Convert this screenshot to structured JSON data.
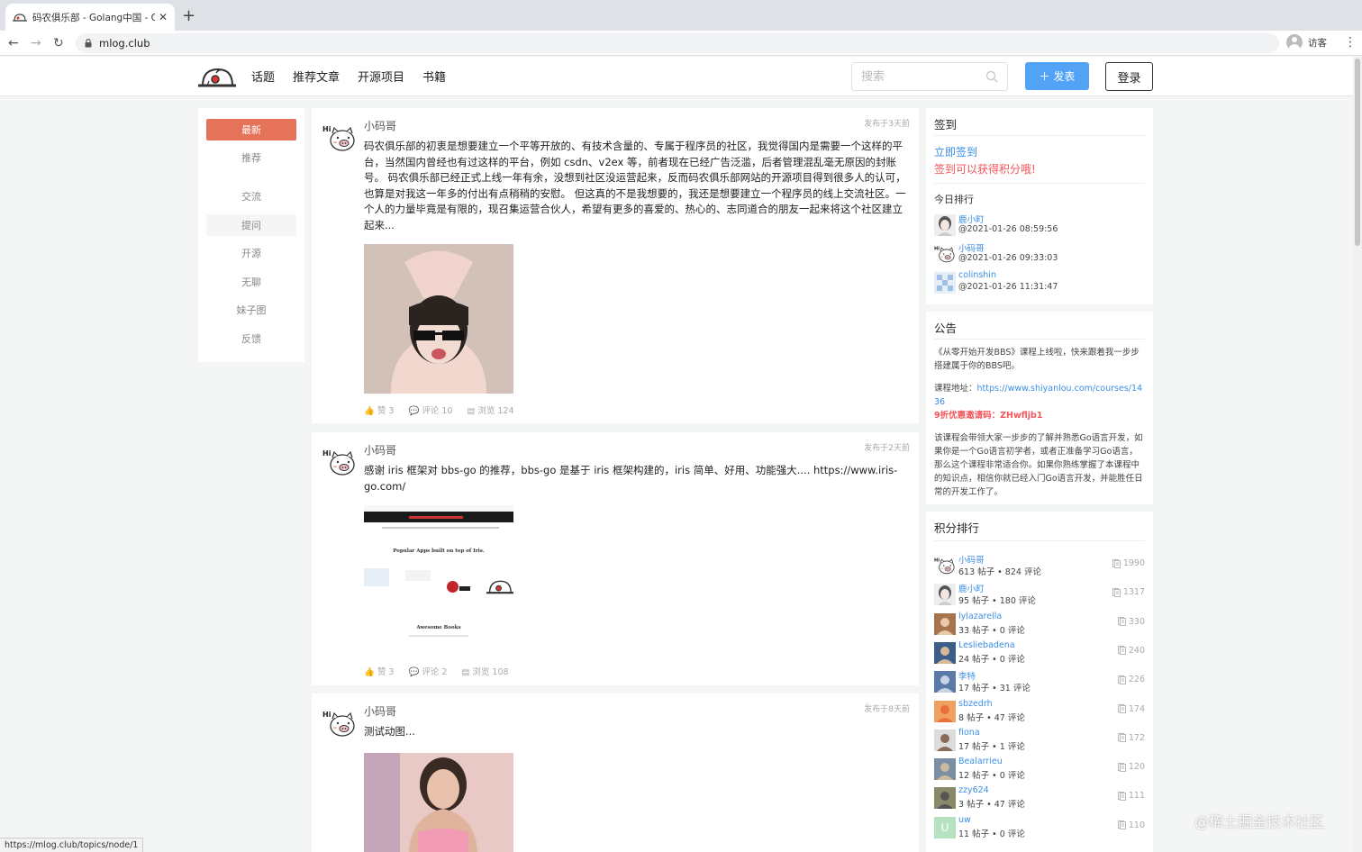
{
  "browser": {
    "tab_title": "码农俱乐部 - Golang中国 - Go语",
    "tab_close": "✕",
    "new_tab": "+",
    "back": "←",
    "forward": "→",
    "reload": "↻",
    "url": "mlog.club",
    "profile_name": "访客",
    "menu": "⋮",
    "status_url": "https://mlog.club/topics/node/1"
  },
  "header": {
    "nav": [
      "话题",
      "推荐文章",
      "开源项目",
      "书籍"
    ],
    "search_placeholder": "搜索",
    "post_button": "＋ 发表",
    "login_button": "登录"
  },
  "sidebar": {
    "items": [
      {
        "label": "最新",
        "state": "active"
      },
      {
        "label": "推荐",
        "state": ""
      },
      {
        "label": "交流",
        "state": ""
      },
      {
        "label": "提问",
        "state": "hover"
      },
      {
        "label": "开源",
        "state": ""
      },
      {
        "label": "无聊",
        "state": ""
      },
      {
        "label": "妹子图",
        "state": ""
      },
      {
        "label": "反馈",
        "state": ""
      }
    ]
  },
  "posts": [
    {
      "author": "小码哥",
      "time": "发布于3天前",
      "content": "码农俱乐部的初衷是想要建立一个平等开放的、有技术含量的、专属于程序员的社区，我觉得国内是需要一个这样的平台，当然国内曾经也有过这样的平台，例如 csdn、v2ex 等，前者现在已经广告泛滥，后者管理混乱毫无原因的封账号。 码农俱乐部已经正式上线一年有余，没想到社区没运营起来，反而码农俱乐部网站的开源项目得到很多人的认可，也算是对我这一年多的付出有点稍稍的安慰。 但这真的不是我想要的，我还是想要建立一个程序员的线上交流社区。一个人的力量毕竟是有限的，现召集运营合伙人，希望有更多的喜爱的、热心的、志同道合的朋友一起来将这个社区建立起来...",
      "likes": "赞 3",
      "comments": "评论 10",
      "views": "浏览 124"
    },
    {
      "author": "小码哥",
      "time": "发布于2天前",
      "content": "感谢 iris 框架对 bbs-go 的推荐，bbs-go 是基于 iris 框架构建的，iris 简单、好用、功能强大.... https://www.iris-go.com/",
      "image_heading": "Popular Apps built on top of Iris.",
      "image_footer": "Awesome Books",
      "likes": "赞 3",
      "comments": "评论 2",
      "views": "浏览 108"
    },
    {
      "author": "小码哥",
      "time": "发布于8天前",
      "content": "测试动图..."
    }
  ],
  "checkin": {
    "title": "签到",
    "link": "立即签到",
    "tip": "签到可以获得积分哦!",
    "today_title": "今日排行",
    "today": [
      {
        "name": "鹿小町",
        "time": "@2021-01-26 08:59:56"
      },
      {
        "name": "小码哥",
        "time": "@2021-01-26 09:33:03"
      },
      {
        "name": "colinshin",
        "time": "@2021-01-26 11:31:47"
      }
    ]
  },
  "notice": {
    "title": "公告",
    "p1": "《从零开始开发BBS》课程上线啦，快来跟着我一步步搭建属于你的BBS吧。",
    "course_label": "课程地址：",
    "course_url": "https://www.shiyanlou.com/courses/1436",
    "coupon_label": "9折优惠邀请码：",
    "coupon_code": "ZHwfljb1",
    "p3": "该课程会带领大家一步步的了解并熟悉Go语言开发，如果你是一个Go语言初学者，或者正准备学习Go语言，那么这个课程非常适合你。如果你熟练掌握了本课程中的知识点，相信你就已经入门Go语言开发，并能胜任日常的开发工作了。"
  },
  "score_rank": {
    "title": "积分排行",
    "rows": [
      {
        "name": "小码哥",
        "stats": "613 帖子 • 824 评论",
        "score": "1990",
        "avatar": "pig"
      },
      {
        "name": "鹿小町",
        "stats": "95 帖子 • 180 评论",
        "score": "1317",
        "avatar": "girl"
      },
      {
        "name": "lylazarella",
        "stats": "33 帖子 • 0 评论",
        "score": "330",
        "avatar": "c1"
      },
      {
        "name": "Lesliebadena",
        "stats": "24 帖子 • 0 评论",
        "score": "240",
        "avatar": "c2"
      },
      {
        "name": "李特",
        "stats": "17 帖子 • 31 评论",
        "score": "226",
        "avatar": "c3"
      },
      {
        "name": "sbzedrh",
        "stats": "8 帖子 • 47 评论",
        "score": "174",
        "avatar": "c4"
      },
      {
        "name": "fiona",
        "stats": "17 帖子 • 1 评论",
        "score": "172",
        "avatar": "c5"
      },
      {
        "name": "Bealarrieu",
        "stats": "12 帖子 • 0 评论",
        "score": "120",
        "avatar": "c6"
      },
      {
        "name": "zzy624",
        "stats": "3 帖子 • 47 评论",
        "score": "111",
        "avatar": "c7"
      },
      {
        "name": "uw",
        "stats": "11 帖子 • 0 评论",
        "score": "110",
        "avatar": "u",
        "letter": "U"
      }
    ]
  },
  "watermark": "@稀土掘金技术社区",
  "colors": {
    "accent": "#e4735a",
    "link": "#3a8ee6",
    "post_button": "#52a3f5",
    "red_text": "#f2555a"
  }
}
